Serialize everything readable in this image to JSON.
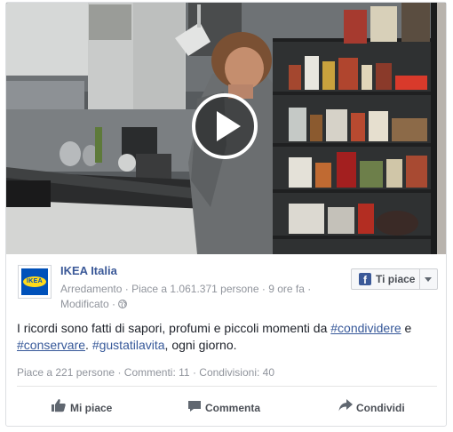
{
  "post": {
    "page_name": "IKEA Italia",
    "logo_text": "IKEA",
    "meta": {
      "category": "Arredamento",
      "likes": "Piace a 1.061.371 persone",
      "time": "9 ore fa",
      "edited": "Modificato"
    },
    "like_page_button": "Ti piace",
    "message": {
      "part1": "I ricordi sono fatti di sapori, profumi e piccoli momenti da ",
      "link1": "#condividere",
      "part2": " e ",
      "link2": "#conservare",
      "part3": ". ",
      "hashtag": "#gustatilavita",
      "part4": ", ogni giorno."
    },
    "stats": {
      "likes": "Piace a 221 persone",
      "comments": "Commenti: 11",
      "shares": "Condivisioni: 40"
    },
    "actions": {
      "like": "Mi piace",
      "comment": "Commenta",
      "share": "Condividi"
    }
  },
  "colors": {
    "link": "#365899",
    "page_name": "#3b5998",
    "meta_gray": "#90949c"
  }
}
